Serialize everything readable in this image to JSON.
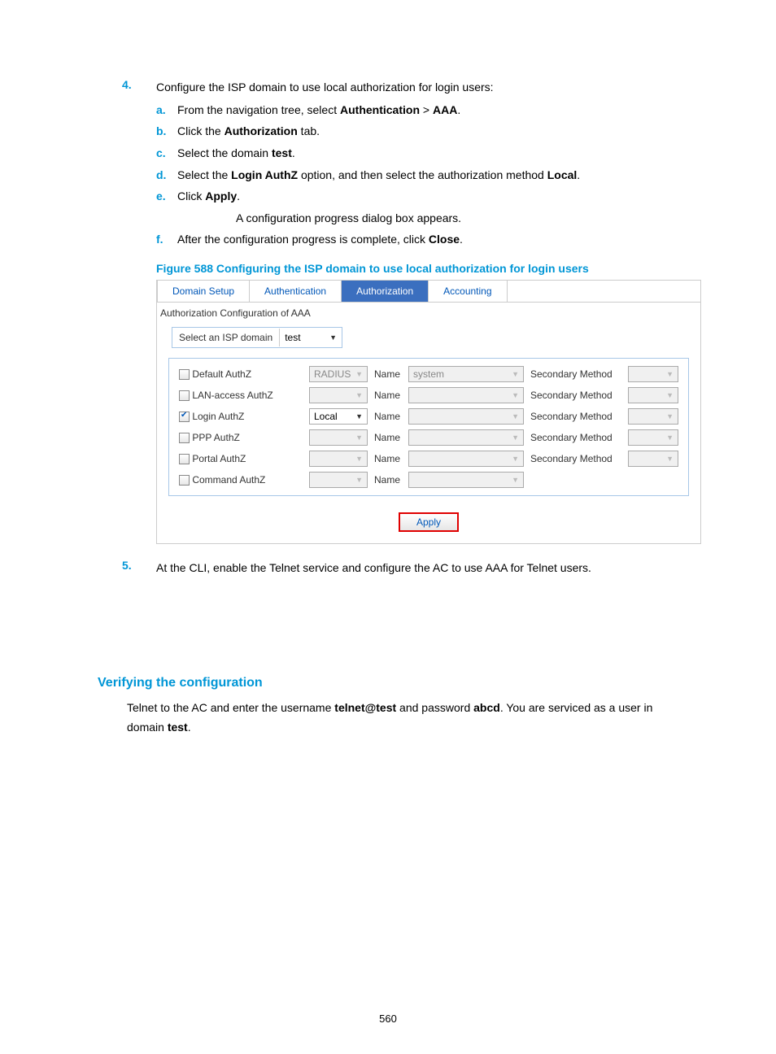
{
  "step4": {
    "num": "4.",
    "intro_pre": "Configure the ISP domain to use local authorization for login users:",
    "a": {
      "mark": "a.",
      "pre": "From the navigation tree, select ",
      "b1": "Authentication",
      "mid": " > ",
      "b2": "AAA",
      "post": "."
    },
    "b": {
      "mark": "b.",
      "pre": "Click the ",
      "b1": "Authorization",
      "post": " tab."
    },
    "c": {
      "mark": "c.",
      "pre": "Select the domain ",
      "b1": "test",
      "post": "."
    },
    "d": {
      "mark": "d.",
      "pre": "Select the ",
      "b1": "Login AuthZ",
      "mid": " option, and then select the authorization method ",
      "b2": "Local",
      "post": "."
    },
    "e": {
      "mark": "e.",
      "pre": "Click ",
      "b1": "Apply",
      "post": ".",
      "note": "A configuration progress dialog box appears."
    },
    "f": {
      "mark": "f.",
      "pre": "After the configuration progress is complete, click ",
      "b1": "Close",
      "post": "."
    }
  },
  "figure_caption": "Figure 588 Configuring the ISP domain to use local authorization for login users",
  "shot": {
    "tabs": [
      "Domain Setup",
      "Authentication",
      "Authorization",
      "Accounting"
    ],
    "active_tab_index": 2,
    "section_label": "Authorization Configuration of AAA",
    "domain_label": "Select an ISP domain",
    "domain_value": "test",
    "name_label": "Name",
    "secondary_label": "Secondary Method",
    "rows": [
      {
        "checked": false,
        "label": "Default AuthZ",
        "method": "RADIUS",
        "method_disabled": true,
        "name": "system",
        "name_disabled": true,
        "has_secondary": true
      },
      {
        "checked": false,
        "label": "LAN-access AuthZ",
        "method": "",
        "method_disabled": true,
        "name": "",
        "name_disabled": true,
        "has_secondary": true
      },
      {
        "checked": true,
        "label": "Login AuthZ",
        "method": "Local",
        "method_disabled": false,
        "name": "",
        "name_disabled": true,
        "has_secondary": true
      },
      {
        "checked": false,
        "label": "PPP AuthZ",
        "method": "",
        "method_disabled": true,
        "name": "",
        "name_disabled": true,
        "has_secondary": true
      },
      {
        "checked": false,
        "label": "Portal AuthZ",
        "method": "",
        "method_disabled": true,
        "name": "",
        "name_disabled": true,
        "has_secondary": true
      },
      {
        "checked": false,
        "label": "Command AuthZ",
        "method": "",
        "method_disabled": true,
        "name": "",
        "name_disabled": true,
        "has_secondary": false
      }
    ],
    "apply_label": "Apply"
  },
  "step5": {
    "num": "5.",
    "text": "At the CLI, enable the Telnet service and configure the AC to use AAA for Telnet users."
  },
  "verify": {
    "heading": "Verifying the configuration",
    "p_pre": "Telnet to the AC and enter the username ",
    "b1": "telnet@test",
    "mid1": " and password ",
    "b2": "abcd",
    "mid2": ". You are serviced as a user in domain ",
    "b3": "test",
    "post": "."
  },
  "page_number": "560"
}
